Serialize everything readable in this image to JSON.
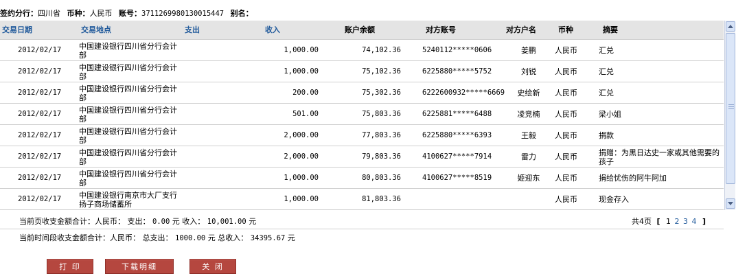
{
  "info": {
    "branch_label": "签约分行：",
    "branch_value": "四川省",
    "currency_label": "币种：",
    "currency_value": "人民币",
    "account_label": "账号：",
    "account_value": "3711269980130015447",
    "alias_label": "别名：",
    "alias_value": ""
  },
  "table": {
    "columns": [
      "交易日期",
      "交易地点",
      "支出",
      "收入",
      "账户余额",
      "对方账号",
      "对方户名",
      "币种",
      "摘要"
    ],
    "rows": [
      {
        "date": "2012/02/17",
        "place": "中国建设银行四川省分行会计部",
        "expense": "",
        "income": "1,000.00",
        "balance": "74,102.36",
        "counter_account": "5240112*****0606",
        "counter_name": "姜鹏",
        "currency": "人民币",
        "memo": "汇兑"
      },
      {
        "date": "2012/02/17",
        "place": "中国建设银行四川省分行会计部",
        "expense": "",
        "income": "1,000.00",
        "balance": "75,102.36",
        "counter_account": "6225880*****5752",
        "counter_name": "刘锐",
        "currency": "人民币",
        "memo": "汇兑"
      },
      {
        "date": "2012/02/17",
        "place": "中国建设银行四川省分行会计部",
        "expense": "",
        "income": "200.00",
        "balance": "75,302.36",
        "counter_account": "6222600932*****6669",
        "counter_name": "史绘新",
        "currency": "人民币",
        "memo": "汇兑"
      },
      {
        "date": "2012/02/17",
        "place": "中国建设银行四川省分行会计部",
        "expense": "",
        "income": "501.00",
        "balance": "75,803.36",
        "counter_account": "6225881*****6488",
        "counter_name": "凌竞楠",
        "currency": "人民币",
        "memo": "梁小姐"
      },
      {
        "date": "2012/02/17",
        "place": "中国建设银行四川省分行会计部",
        "expense": "",
        "income": "2,000.00",
        "balance": "77,803.36",
        "counter_account": "6225880*****6393",
        "counter_name": "王毅",
        "currency": "人民币",
        "memo": "捐款"
      },
      {
        "date": "2012/02/17",
        "place": "中国建设银行四川省分行会计部",
        "expense": "",
        "income": "2,000.00",
        "balance": "79,803.36",
        "counter_account": "4100627*****7914",
        "counter_name": "雷力",
        "currency": "人民币",
        "memo": "捐赠：为黑日达史一家或其他需要的孩子"
      },
      {
        "date": "2012/02/17",
        "place": "中国建设银行四川省分行会计部",
        "expense": "",
        "income": "1,000.00",
        "balance": "80,803.36",
        "counter_account": "4100627*****8519",
        "counter_name": "姬迎东",
        "currency": "人民币",
        "memo": "捐给忧伤的阿牛阿加"
      },
      {
        "date": "2012/02/17",
        "place": "中国建设银行南京市大厂支行扬子商场储蓄所",
        "expense": "",
        "income": "1,000.00",
        "balance": "81,803.36",
        "counter_account": "",
        "counter_name": "",
        "currency": "人民币",
        "memo": "现金存入"
      }
    ]
  },
  "summary_page": {
    "label": "当前页收支金额合计：人民币：",
    "expense_label": "支出：",
    "expense_value": "0.00",
    "unit1": "元",
    "income_label": "收入：",
    "income_value": "10,001.00",
    "unit2": "元"
  },
  "pagination": {
    "total_label": "共4页",
    "open": "[",
    "close": "]",
    "pages": [
      "1",
      "2",
      "3",
      "4"
    ]
  },
  "summary_period": {
    "label": "当前时间段收支金额合计：人民币：",
    "expense_label": "总支出：",
    "expense_value": "1000.00",
    "unit1": "元",
    "income_label": "总收入：",
    "income_value": "34395.67",
    "unit2": "元"
  },
  "buttons": {
    "print": "打 印",
    "download": "下载明细",
    "close": "关 闭"
  },
  "colors": {
    "button_bg": "#b5473f",
    "header_bg": "#e4e4e4",
    "link": "#215a9b"
  }
}
